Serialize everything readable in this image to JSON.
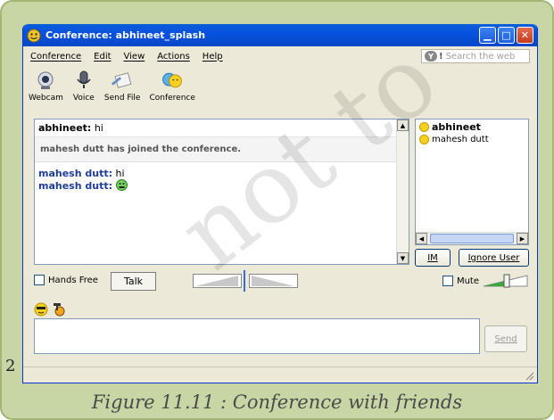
{
  "window": {
    "title": "Conference: abhineet_splash"
  },
  "menu": [
    "Conference",
    "Edit",
    "View",
    "Actions",
    "Help"
  ],
  "search": {
    "placeholder": "Search the web"
  },
  "toolbar": [
    {
      "label": "Webcam",
      "icon": "webcam-icon"
    },
    {
      "label": "Voice",
      "icon": "microphone-icon"
    },
    {
      "label": "Send File",
      "icon": "send-file-icon"
    },
    {
      "label": "Conference",
      "icon": "conference-icon"
    }
  ],
  "chat": {
    "first_sender": "abhineet:",
    "first_text": "hi",
    "system_message": "mahesh dutt has joined the conference.",
    "messages": [
      {
        "sender": "mahesh dutt:",
        "text": "hi"
      },
      {
        "sender": "mahesh dutt:",
        "text": "",
        "emoticon": "green-smiley-icon"
      }
    ]
  },
  "participants": [
    {
      "name": "abhineet",
      "bold": true
    },
    {
      "name": "mahesh dutt",
      "bold": false
    }
  ],
  "buttons": {
    "im": "IM",
    "ignore_user": "Ignore User",
    "talk": "Talk",
    "send": "Send"
  },
  "controls": {
    "hands_free": "Hands Free",
    "mute": "Mute"
  },
  "caption": "Figure 11.11 : Conference with friends",
  "watermark": "not to",
  "edge_char": "2",
  "colors": {
    "frame": "#c7d6a4",
    "titlebar": "#0a5fd6",
    "sender": "#1f3e9a"
  }
}
